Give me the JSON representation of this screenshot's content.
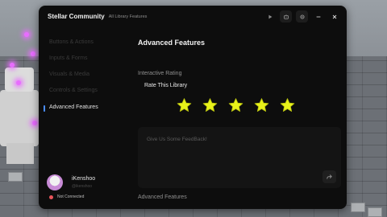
{
  "window": {
    "title": "Stellar Community",
    "subtitle": "All Library Features"
  },
  "title_controls": [
    {
      "icon": "play-icon"
    },
    {
      "icon": "robot-icon"
    },
    {
      "icon": "settings-icon"
    },
    {
      "icon": "minimize-icon"
    },
    {
      "icon": "close-icon"
    }
  ],
  "sidebar": {
    "items": [
      {
        "label": "Buttons & Actions",
        "active": false
      },
      {
        "label": "Inputs & Forms",
        "active": false
      },
      {
        "label": "Visuals & Media",
        "active": false
      },
      {
        "label": "Controls & Settings",
        "active": false
      },
      {
        "label": "Advanced Features",
        "active": true
      }
    ],
    "accent": "#4a8dff"
  },
  "user": {
    "name": "iKenshoo",
    "handle": "@ikenshoo",
    "status": "Not Connected",
    "status_color": "#e8545a"
  },
  "content": {
    "page_title": "Advanced Features",
    "section_interactive": "Interactive Rating",
    "rating": {
      "title": "Rate This Library",
      "stars_total": 5,
      "stars_filled": 5,
      "star_color": "#e8f21a"
    },
    "feedback": {
      "placeholder": "Give Us Some FeedBack!",
      "value": ""
    },
    "section_bottom": "Advanced Features"
  }
}
